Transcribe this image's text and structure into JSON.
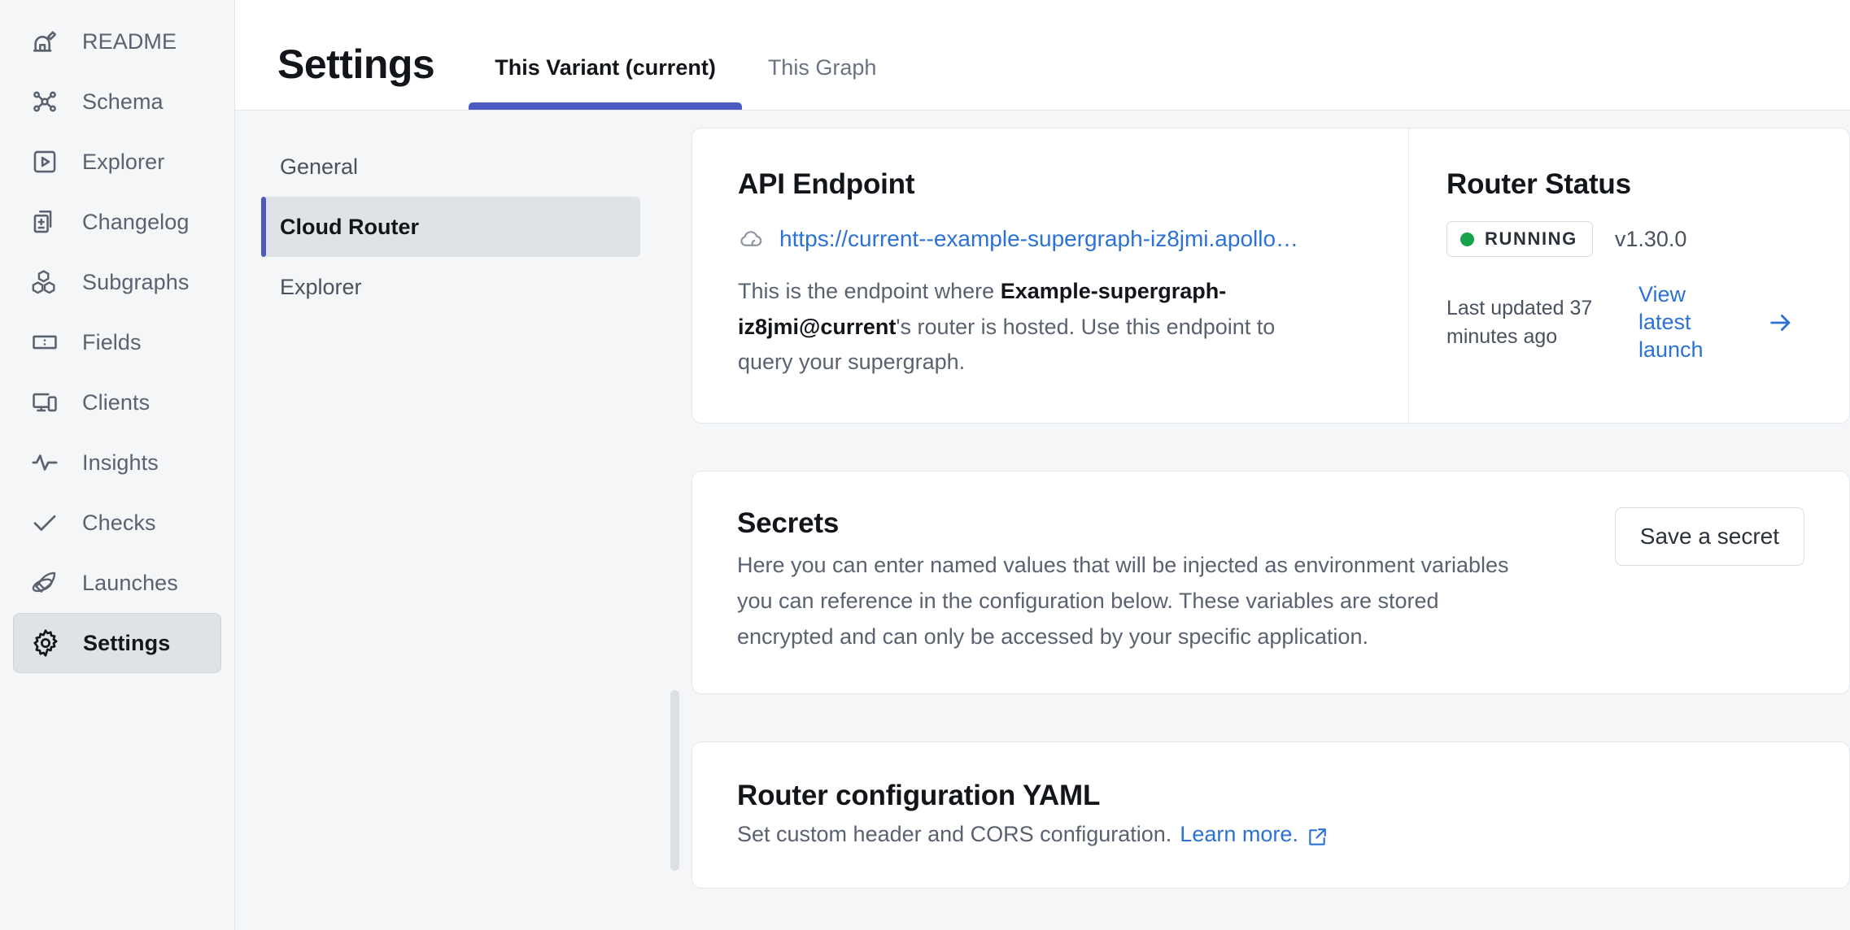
{
  "sidebar": {
    "items": [
      {
        "label": "README",
        "icon": "observatory-icon",
        "active": false
      },
      {
        "label": "Schema",
        "icon": "schema-graph-icon",
        "active": false
      },
      {
        "label": "Explorer",
        "icon": "play-square-icon",
        "active": false
      },
      {
        "label": "Changelog",
        "icon": "documents-plusminus-icon",
        "active": false
      },
      {
        "label": "Subgraphs",
        "icon": "cubes-icon",
        "active": false
      },
      {
        "label": "Fields",
        "icon": "fields-rectangle-icon",
        "active": false
      },
      {
        "label": "Clients",
        "icon": "devices-icon",
        "active": false
      },
      {
        "label": "Insights",
        "icon": "pulse-icon",
        "active": false
      },
      {
        "label": "Checks",
        "icon": "check-icon",
        "active": false
      },
      {
        "label": "Launches",
        "icon": "rocket-icon",
        "active": false
      },
      {
        "label": "Settings",
        "icon": "gear-icon",
        "active": true
      }
    ]
  },
  "header": {
    "title": "Settings",
    "tabs": [
      {
        "label": "This Variant (current)",
        "active": true
      },
      {
        "label": "This Graph",
        "active": false
      }
    ]
  },
  "subnav": {
    "items": [
      {
        "label": "General",
        "active": false
      },
      {
        "label": "Cloud Router",
        "active": true
      },
      {
        "label": "Explorer",
        "active": false
      }
    ]
  },
  "api_endpoint": {
    "title": "API Endpoint",
    "url": "https://current--example-supergraph-iz8jmi.apollo…",
    "icon": "cloud-icon",
    "description_pre": "This is the endpoint where ",
    "description_bold": "Example-supergraph-iz8jmi@current",
    "description_post": "'s router is hosted. Use this endpoint to query your supergraph."
  },
  "router_status": {
    "title": "Router Status",
    "status": "RUNNING",
    "status_color": "#16a34a",
    "version": "v1.30.0",
    "last_updated": "Last updated 37 minutes ago",
    "link_label": "View latest launch",
    "arrow_icon": "arrow-right-icon"
  },
  "secrets": {
    "title": "Secrets",
    "description": "Here you can enter named values that will be injected as environment variables you can reference in the configuration below. These variables are stored encrypted and can only be accessed by your specific application.",
    "save_label": "Save a secret"
  },
  "yaml": {
    "title": "Router configuration YAML",
    "description": "Set custom header and CORS configuration.",
    "link_label": "Learn more.",
    "link_icon": "external-link-icon"
  },
  "colors": {
    "accent": "#4c5bbf",
    "link": "#2c72d6",
    "running": "#16a34a"
  }
}
